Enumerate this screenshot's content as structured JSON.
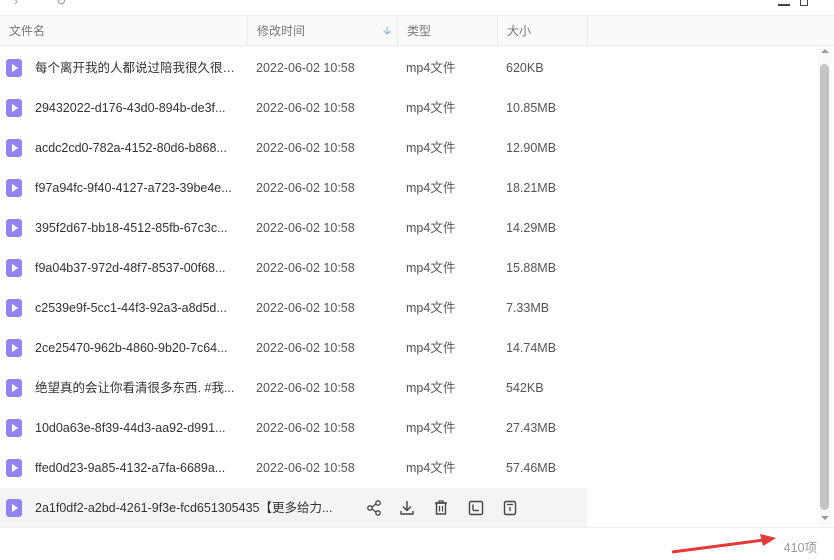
{
  "colors": {
    "accent": "#3b8ff4",
    "file_icon": "#8f84f2",
    "arrow": "#e53935",
    "hover_row": "#f3f4f6"
  },
  "columns": {
    "name": "文件名",
    "time": "修改时间",
    "type": "类型",
    "size": "大小"
  },
  "files": [
    {
      "name": "每个离开我的人都说过陪我很久很久...",
      "time": "2022-06-02 10:58",
      "type": "mp4文件",
      "size": "620KB"
    },
    {
      "name": "29432022-d176-43d0-894b-de3f...",
      "time": "2022-06-02 10:58",
      "type": "mp4文件",
      "size": "10.85MB"
    },
    {
      "name": "acdc2cd0-782a-4152-80d6-b868...",
      "time": "2022-06-02 10:58",
      "type": "mp4文件",
      "size": "12.90MB"
    },
    {
      "name": "f97a94fc-9f40-4127-a723-39be4e...",
      "time": "2022-06-02 10:58",
      "type": "mp4文件",
      "size": "18.21MB"
    },
    {
      "name": "395f2d67-bb18-4512-85fb-67c3c...",
      "time": "2022-06-02 10:58",
      "type": "mp4文件",
      "size": "14.29MB"
    },
    {
      "name": "f9a04b37-972d-48f7-8537-00f68...",
      "time": "2022-06-02 10:58",
      "type": "mp4文件",
      "size": "15.88MB"
    },
    {
      "name": "c2539e9f-5cc1-44f3-92a3-a8d5d...",
      "time": "2022-06-02 10:58",
      "type": "mp4文件",
      "size": "7.33MB"
    },
    {
      "name": "2ce25470-962b-4860-9b20-7c64...",
      "time": "2022-06-02 10:58",
      "type": "mp4文件",
      "size": "14.74MB"
    },
    {
      "name": "绝望真的会让你看清很多东西. #我...",
      "time": "2022-06-02 10:58",
      "type": "mp4文件",
      "size": "542KB"
    },
    {
      "name": "10d0a63e-8f39-44d3-aa92-d991...",
      "time": "2022-06-02 10:58",
      "type": "mp4文件",
      "size": "27.43MB"
    },
    {
      "name": "ffed0d23-9a85-4132-a7fa-6689a...",
      "time": "2022-06-02 10:58",
      "type": "mp4文件",
      "size": "57.46MB"
    }
  ],
  "hovered_file": {
    "name": "2a1f0df2-a2bd-4261-9f3e-fcd651305435【更多给力..."
  },
  "row_actions": [
    "share-icon",
    "download-icon",
    "delete-icon",
    "rename-icon",
    "more-icon"
  ],
  "footer": {
    "count": "410项"
  }
}
